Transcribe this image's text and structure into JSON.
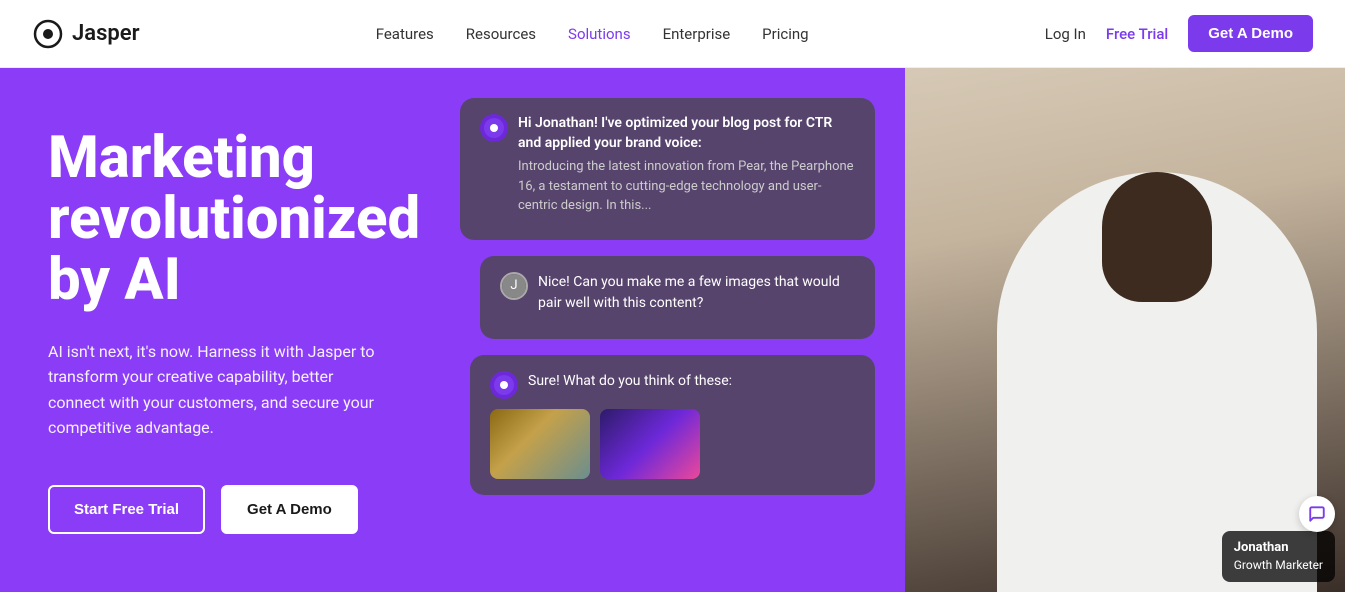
{
  "navbar": {
    "logo_text": "Jasper",
    "links": [
      {
        "label": "Features",
        "id": "features",
        "active": false
      },
      {
        "label": "Resources",
        "id": "resources",
        "active": false
      },
      {
        "label": "Solutions",
        "id": "solutions",
        "active": true
      },
      {
        "label": "Enterprise",
        "id": "enterprise",
        "active": false
      },
      {
        "label": "Pricing",
        "id": "pricing",
        "active": false
      }
    ],
    "login_label": "Log In",
    "free_trial_label": "Free Trial",
    "demo_label": "Get A Demo"
  },
  "hero": {
    "title": "Marketing revolutionized by AI",
    "subtitle": "AI isn't next, it's now. Harness it with Jasper to transform your creative capability, better connect with your customers, and secure your competitive advantage.",
    "start_trial_label": "Start Free Trial",
    "get_demo_label": "Get A Demo"
  },
  "chat": {
    "bubble1": {
      "header": "Hi Jonathan! I've optimized your blog post for CTR and applied your brand voice:",
      "body": "Introducing the latest innovation from Pear, the Pearphone 16, a testament to cutting-edge technology and user-centric design. In this..."
    },
    "bubble2": {
      "text": "Nice! Can you make me a few images that would pair well with this content?"
    },
    "bubble3": {
      "text": "Sure! What do you think of these:"
    }
  },
  "person": {
    "name": "Jonathan",
    "title": "Growth Marketer"
  },
  "colors": {
    "purple_primary": "#8b3cf7",
    "purple_dark": "#7c3aed",
    "white": "#ffffff"
  }
}
